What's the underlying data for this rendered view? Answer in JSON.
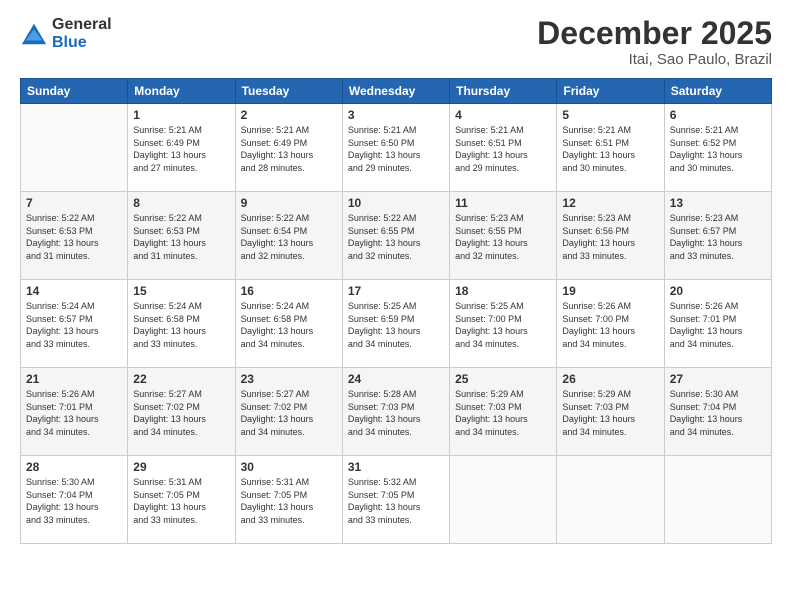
{
  "logo": {
    "general": "General",
    "blue": "Blue"
  },
  "header": {
    "month_year": "December 2025",
    "location": "Itai, Sao Paulo, Brazil"
  },
  "weekdays": [
    "Sunday",
    "Monday",
    "Tuesday",
    "Wednesday",
    "Thursday",
    "Friday",
    "Saturday"
  ],
  "weeks": [
    [
      {
        "day": "",
        "info": ""
      },
      {
        "day": "1",
        "info": "Sunrise: 5:21 AM\nSunset: 6:49 PM\nDaylight: 13 hours\nand 27 minutes."
      },
      {
        "day": "2",
        "info": "Sunrise: 5:21 AM\nSunset: 6:49 PM\nDaylight: 13 hours\nand 28 minutes."
      },
      {
        "day": "3",
        "info": "Sunrise: 5:21 AM\nSunset: 6:50 PM\nDaylight: 13 hours\nand 29 minutes."
      },
      {
        "day": "4",
        "info": "Sunrise: 5:21 AM\nSunset: 6:51 PM\nDaylight: 13 hours\nand 29 minutes."
      },
      {
        "day": "5",
        "info": "Sunrise: 5:21 AM\nSunset: 6:51 PM\nDaylight: 13 hours\nand 30 minutes."
      },
      {
        "day": "6",
        "info": "Sunrise: 5:21 AM\nSunset: 6:52 PM\nDaylight: 13 hours\nand 30 minutes."
      }
    ],
    [
      {
        "day": "7",
        "info": "Sunrise: 5:22 AM\nSunset: 6:53 PM\nDaylight: 13 hours\nand 31 minutes."
      },
      {
        "day": "8",
        "info": "Sunrise: 5:22 AM\nSunset: 6:53 PM\nDaylight: 13 hours\nand 31 minutes."
      },
      {
        "day": "9",
        "info": "Sunrise: 5:22 AM\nSunset: 6:54 PM\nDaylight: 13 hours\nand 32 minutes."
      },
      {
        "day": "10",
        "info": "Sunrise: 5:22 AM\nSunset: 6:55 PM\nDaylight: 13 hours\nand 32 minutes."
      },
      {
        "day": "11",
        "info": "Sunrise: 5:23 AM\nSunset: 6:55 PM\nDaylight: 13 hours\nand 32 minutes."
      },
      {
        "day": "12",
        "info": "Sunrise: 5:23 AM\nSunset: 6:56 PM\nDaylight: 13 hours\nand 33 minutes."
      },
      {
        "day": "13",
        "info": "Sunrise: 5:23 AM\nSunset: 6:57 PM\nDaylight: 13 hours\nand 33 minutes."
      }
    ],
    [
      {
        "day": "14",
        "info": "Sunrise: 5:24 AM\nSunset: 6:57 PM\nDaylight: 13 hours\nand 33 minutes."
      },
      {
        "day": "15",
        "info": "Sunrise: 5:24 AM\nSunset: 6:58 PM\nDaylight: 13 hours\nand 33 minutes."
      },
      {
        "day": "16",
        "info": "Sunrise: 5:24 AM\nSunset: 6:58 PM\nDaylight: 13 hours\nand 34 minutes."
      },
      {
        "day": "17",
        "info": "Sunrise: 5:25 AM\nSunset: 6:59 PM\nDaylight: 13 hours\nand 34 minutes."
      },
      {
        "day": "18",
        "info": "Sunrise: 5:25 AM\nSunset: 7:00 PM\nDaylight: 13 hours\nand 34 minutes."
      },
      {
        "day": "19",
        "info": "Sunrise: 5:26 AM\nSunset: 7:00 PM\nDaylight: 13 hours\nand 34 minutes."
      },
      {
        "day": "20",
        "info": "Sunrise: 5:26 AM\nSunset: 7:01 PM\nDaylight: 13 hours\nand 34 minutes."
      }
    ],
    [
      {
        "day": "21",
        "info": "Sunrise: 5:26 AM\nSunset: 7:01 PM\nDaylight: 13 hours\nand 34 minutes."
      },
      {
        "day": "22",
        "info": "Sunrise: 5:27 AM\nSunset: 7:02 PM\nDaylight: 13 hours\nand 34 minutes."
      },
      {
        "day": "23",
        "info": "Sunrise: 5:27 AM\nSunset: 7:02 PM\nDaylight: 13 hours\nand 34 minutes."
      },
      {
        "day": "24",
        "info": "Sunrise: 5:28 AM\nSunset: 7:03 PM\nDaylight: 13 hours\nand 34 minutes."
      },
      {
        "day": "25",
        "info": "Sunrise: 5:29 AM\nSunset: 7:03 PM\nDaylight: 13 hours\nand 34 minutes."
      },
      {
        "day": "26",
        "info": "Sunrise: 5:29 AM\nSunset: 7:03 PM\nDaylight: 13 hours\nand 34 minutes."
      },
      {
        "day": "27",
        "info": "Sunrise: 5:30 AM\nSunset: 7:04 PM\nDaylight: 13 hours\nand 34 minutes."
      }
    ],
    [
      {
        "day": "28",
        "info": "Sunrise: 5:30 AM\nSunset: 7:04 PM\nDaylight: 13 hours\nand 33 minutes."
      },
      {
        "day": "29",
        "info": "Sunrise: 5:31 AM\nSunset: 7:05 PM\nDaylight: 13 hours\nand 33 minutes."
      },
      {
        "day": "30",
        "info": "Sunrise: 5:31 AM\nSunset: 7:05 PM\nDaylight: 13 hours\nand 33 minutes."
      },
      {
        "day": "31",
        "info": "Sunrise: 5:32 AM\nSunset: 7:05 PM\nDaylight: 13 hours\nand 33 minutes."
      },
      {
        "day": "",
        "info": ""
      },
      {
        "day": "",
        "info": ""
      },
      {
        "day": "",
        "info": ""
      }
    ]
  ]
}
